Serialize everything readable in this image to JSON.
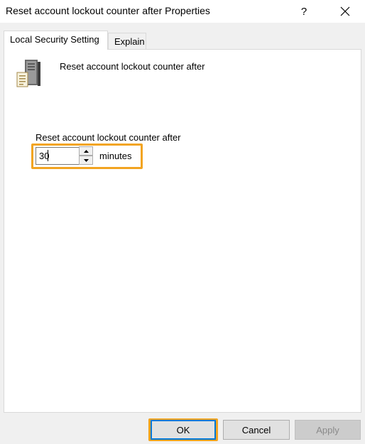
{
  "window": {
    "title": "Reset account lockout counter after Properties",
    "help_glyph": "?",
    "close_icon": "close-icon"
  },
  "tabs": [
    {
      "label": "Local Security Setting",
      "selected": true
    },
    {
      "label": "Explain",
      "selected": false
    }
  ],
  "policy": {
    "icon": "server-document-icon",
    "name": "Reset account lockout counter after"
  },
  "setting": {
    "label": "Reset account lockout counter after",
    "value": "30",
    "unit": "minutes"
  },
  "buttons": {
    "ok": "OK",
    "cancel": "Cancel",
    "apply": "Apply"
  },
  "colors": {
    "highlight": "#f2a421",
    "default_button_border": "#0078d7"
  }
}
